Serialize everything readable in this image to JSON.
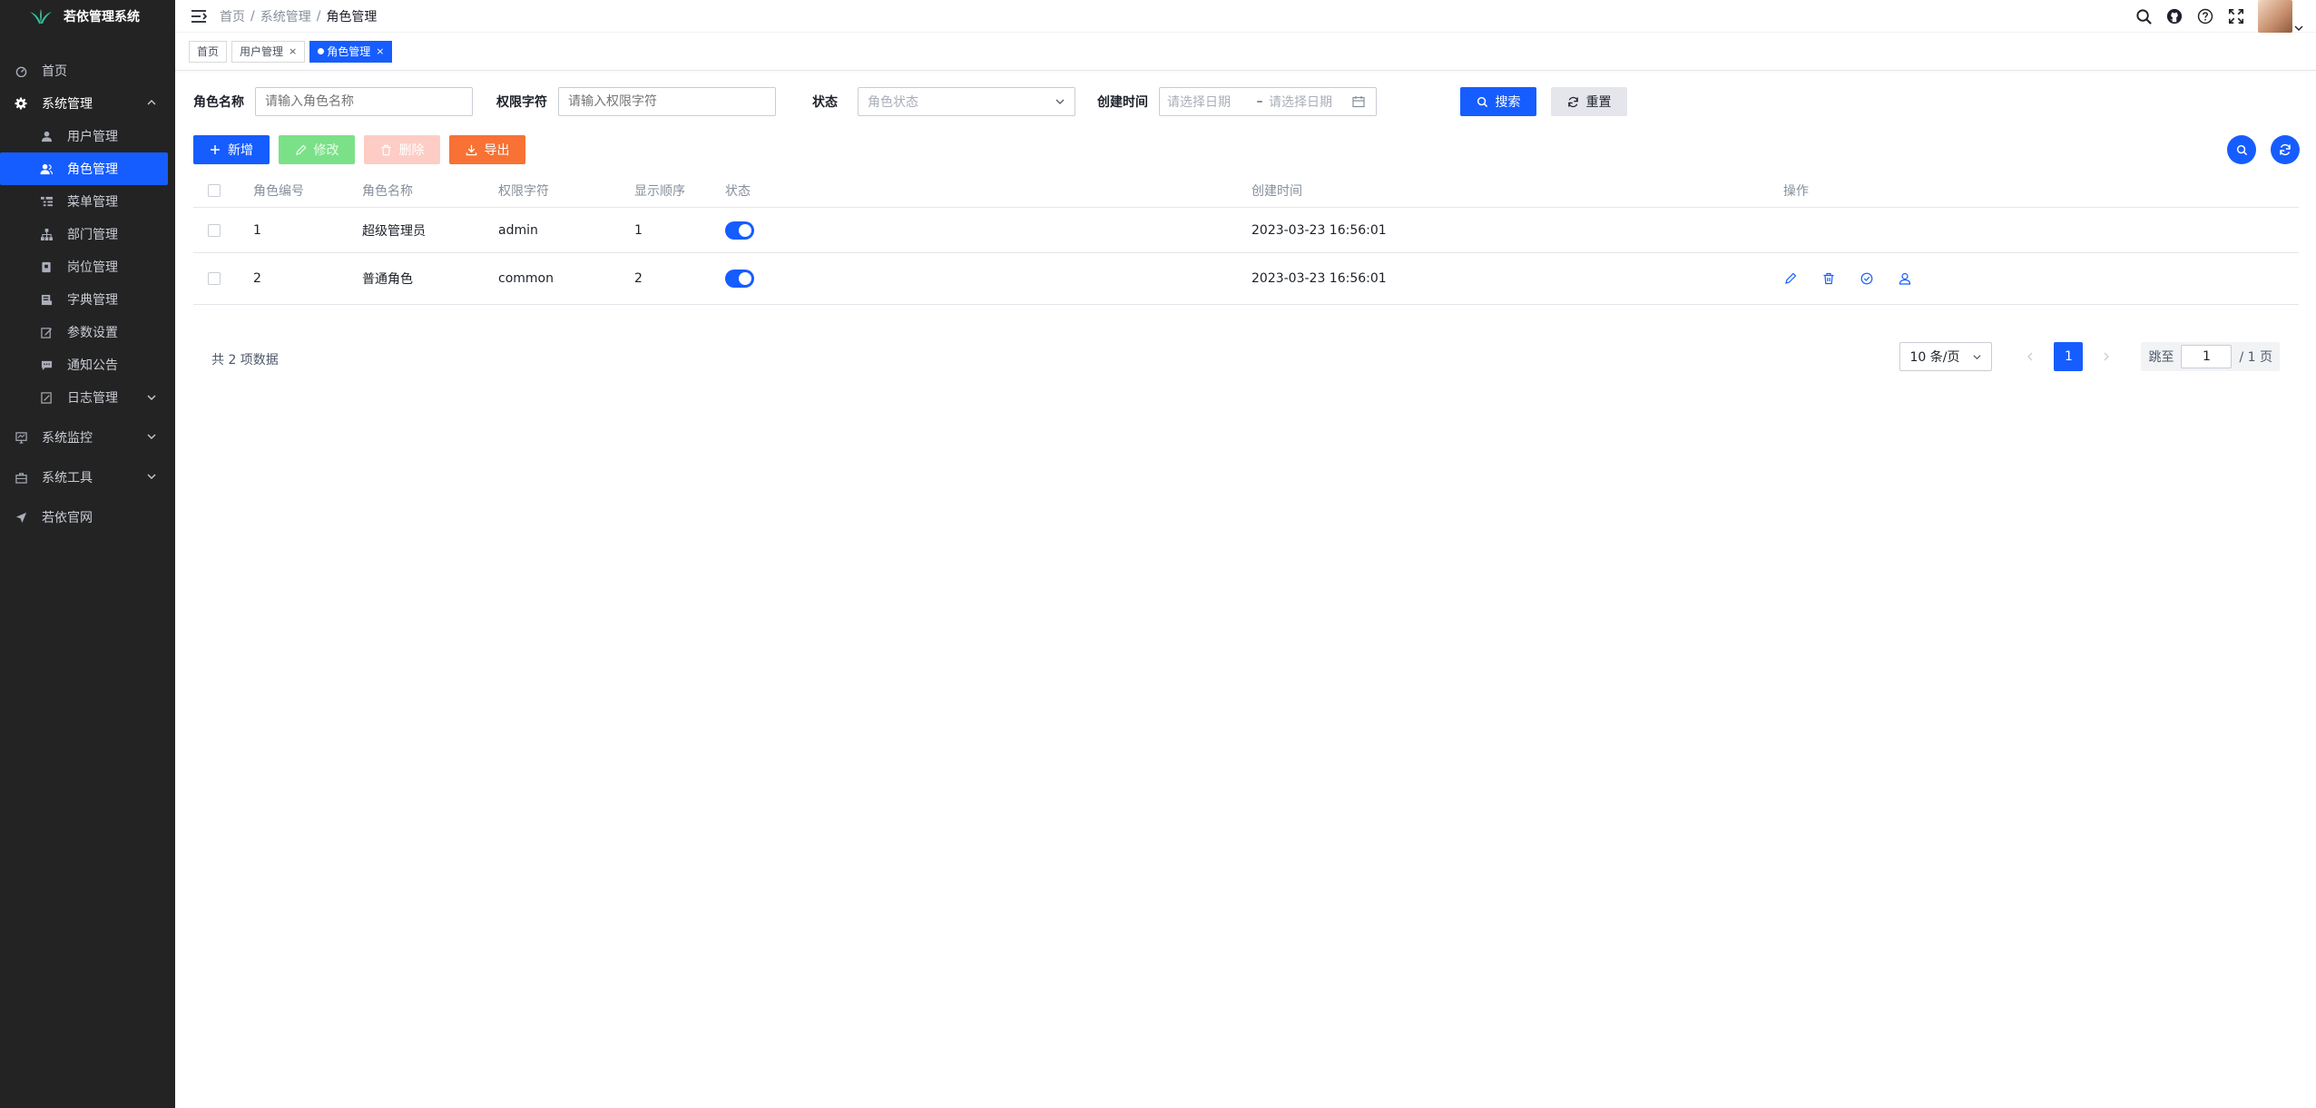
{
  "app": {
    "title": "若依管理系统"
  },
  "sidebar": {
    "items": [
      {
        "label": "首页",
        "icon": "dashboard-icon"
      },
      {
        "label": "系统管理",
        "icon": "gear-icon",
        "expanded": true,
        "children": [
          {
            "label": "用户管理",
            "icon": "user-icon"
          },
          {
            "label": "角色管理",
            "icon": "user-group-icon",
            "active": true
          },
          {
            "label": "菜单管理",
            "icon": "tree-table-icon"
          },
          {
            "label": "部门管理",
            "icon": "tree-icon"
          },
          {
            "label": "岗位管理",
            "icon": "post-icon"
          },
          {
            "label": "字典管理",
            "icon": "dict-icon"
          },
          {
            "label": "参数设置",
            "icon": "edit-icon"
          },
          {
            "label": "通知公告",
            "icon": "message-icon"
          },
          {
            "label": "日志管理",
            "icon": "log-icon"
          }
        ]
      },
      {
        "label": "系统监控",
        "icon": "monitor-icon"
      },
      {
        "label": "系统工具",
        "icon": "tool-icon"
      },
      {
        "label": "若依官网",
        "icon": "guide-icon"
      }
    ]
  },
  "header": {
    "breadcrumb": [
      "首页",
      "系统管理",
      "角色管理"
    ],
    "separator": "/"
  },
  "tabs": [
    {
      "label": "首页",
      "closable": false
    },
    {
      "label": "用户管理",
      "closable": true
    },
    {
      "label": "角色管理",
      "closable": true,
      "active": true
    }
  ],
  "tab_close_glyph": "×",
  "search": {
    "role_name": {
      "label": "角色名称",
      "placeholder": "请输入角色名称"
    },
    "role_key": {
      "label": "权限字符",
      "placeholder": "请输入权限字符"
    },
    "status": {
      "label": "状态",
      "placeholder": "角色状态"
    },
    "created": {
      "label": "创建时间",
      "start_placeholder": "请选择日期",
      "end_placeholder": "请选择日期",
      "separator": "–"
    },
    "search_button": "搜索",
    "reset_button": "重置"
  },
  "toolbar": {
    "add": "新增",
    "edit": "修改",
    "delete": "删除",
    "export": "导出"
  },
  "table": {
    "columns": [
      "角色编号",
      "角色名称",
      "权限字符",
      "显示顺序",
      "状态",
      "创建时间",
      "操作"
    ],
    "rows": [
      {
        "id": "1",
        "name": "超级管理员",
        "key": "admin",
        "order": "1",
        "status": true,
        "created": "2023-03-23 16:56:01"
      },
      {
        "id": "2",
        "name": "普通角色",
        "key": "common",
        "order": "2",
        "status": true,
        "created": "2023-03-23 16:56:01"
      }
    ]
  },
  "footer": {
    "total": "共 2 项数据",
    "page_size": "10 条/页",
    "current_page": "1",
    "jump_label": "跳至",
    "jump_value": "1",
    "total_pages": "/ 1 页"
  },
  "colors": {
    "primary": "#165dff",
    "sidebar_bg": "#232324",
    "export": "#f77234",
    "edit_disabled": "#7be188",
    "delete_disabled": "#fdcdc5"
  }
}
